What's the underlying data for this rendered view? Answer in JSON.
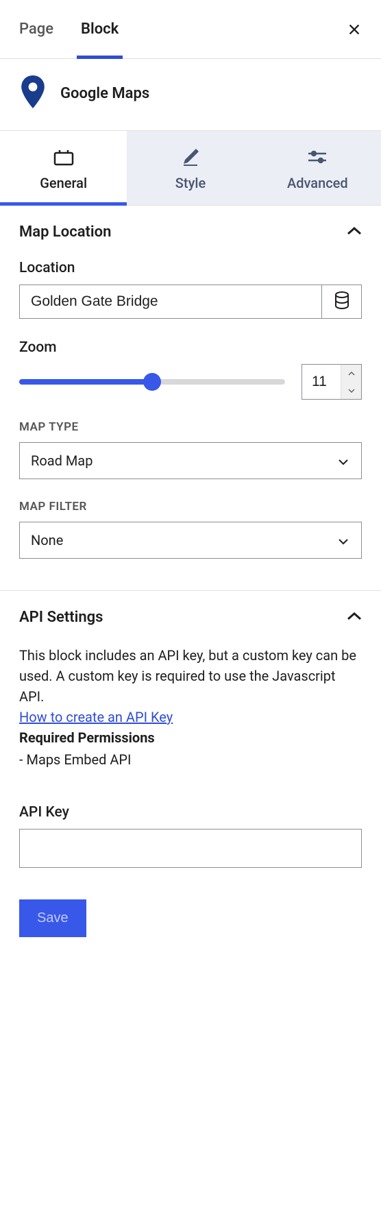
{
  "topTabs": {
    "page": "Page",
    "block": "Block"
  },
  "block": {
    "title": "Google Maps"
  },
  "subTabs": {
    "general": "General",
    "style": "Style",
    "advanced": "Advanced"
  },
  "mapLocation": {
    "title": "Map Location",
    "locationLabel": "Location",
    "locationValue": "Golden Gate Bridge",
    "zoomLabel": "Zoom",
    "zoomValue": "11",
    "mapTypeLabel": "MAP TYPE",
    "mapTypeValue": "Road Map",
    "mapFilterLabel": "MAP FILTER",
    "mapFilterValue": "None"
  },
  "apiSettings": {
    "title": "API Settings",
    "desc": "This block includes an API key, but a custom key can be used. A custom key is required to use the Javascript API.",
    "link": "How to create an API Key",
    "permsTitle": "Required Permissions",
    "perm1": "- Maps Embed API",
    "apiKeyLabel": "API Key",
    "apiKeyValue": "",
    "saveLabel": "Save"
  }
}
